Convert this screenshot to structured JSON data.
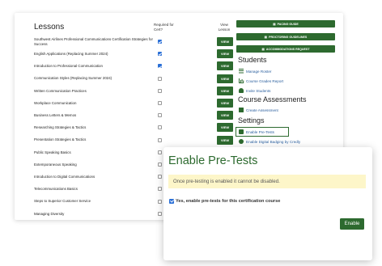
{
  "lessons": {
    "title": "Lessons",
    "col_required": "Required for Cert?",
    "col_view": "View Lesson",
    "view_label": "VIEW",
    "rows": [
      {
        "name": "Southwest Airlines Professional Communications Certification Strategies for Success",
        "required": true,
        "has_view": true
      },
      {
        "name": "English Applications (Replacing Summer 2024)",
        "required": true,
        "has_view": true
      },
      {
        "name": "Introduction to Professional Communication",
        "required": true,
        "has_view": true
      },
      {
        "name": "Communication Styles (Replacing Summer 2024)",
        "required": false,
        "has_view": true
      },
      {
        "name": "Written Communication Practices",
        "required": false,
        "has_view": true
      },
      {
        "name": "Workplace Communication",
        "required": false,
        "has_view": true
      },
      {
        "name": "Business Letters & Memos",
        "required": false,
        "has_view": true
      },
      {
        "name": "Researching Strategies & Tactics",
        "required": false,
        "has_view": true
      },
      {
        "name": "Presentation Strategies & Tactics",
        "required": false,
        "has_view": true
      },
      {
        "name": "Public Speaking Basics",
        "required": false,
        "has_view": false
      },
      {
        "name": "Extemporaneous Speaking",
        "required": false,
        "has_view": false
      },
      {
        "name": "Introduction to Digital Communications",
        "required": false,
        "has_view": false
      },
      {
        "name": "Telecommunications Basics",
        "required": false,
        "has_view": false
      },
      {
        "name": "Steps to Superior Customer Service",
        "required": false,
        "has_view": false
      },
      {
        "name": "Managing Diversity",
        "required": false,
        "has_view": false
      }
    ]
  },
  "sidebar": {
    "buttons": [
      "PACING GUIDE",
      "PROCTORING GUIDELINES",
      "ACCOMMODATIONS REQUEST"
    ],
    "students_heading": "Students",
    "students_links": [
      {
        "label": "Manage Roster",
        "icon": "list-icon"
      },
      {
        "label": "Course Grades Report",
        "icon": "chart-icon"
      },
      {
        "label": "Invite Students",
        "icon": "users-icon"
      }
    ],
    "assessments_heading": "Course Assessments",
    "assessments_links": [
      {
        "label": "Create Assessment",
        "icon": "document-icon"
      }
    ],
    "settings_heading": "Settings",
    "settings_links": [
      {
        "label": "Enable Pre-Tests",
        "icon": "checkbox-icon"
      },
      {
        "label": "Enable Digital Badging by Credly",
        "icon": "badge-icon"
      }
    ]
  },
  "modal": {
    "title": "Enable Pre-Tests",
    "alert": "Once pre-testing is enabled it cannot be disabled.",
    "checkbox_label": "Yes, enable pre-tests for this certification course",
    "checkbox_checked": true,
    "button_label": "Enable"
  },
  "colors": {
    "accent": "#2d6a2f",
    "link": "#2a5f9e",
    "alert_bg": "#fdf6c9",
    "checkbox": "#2a6fd6"
  }
}
